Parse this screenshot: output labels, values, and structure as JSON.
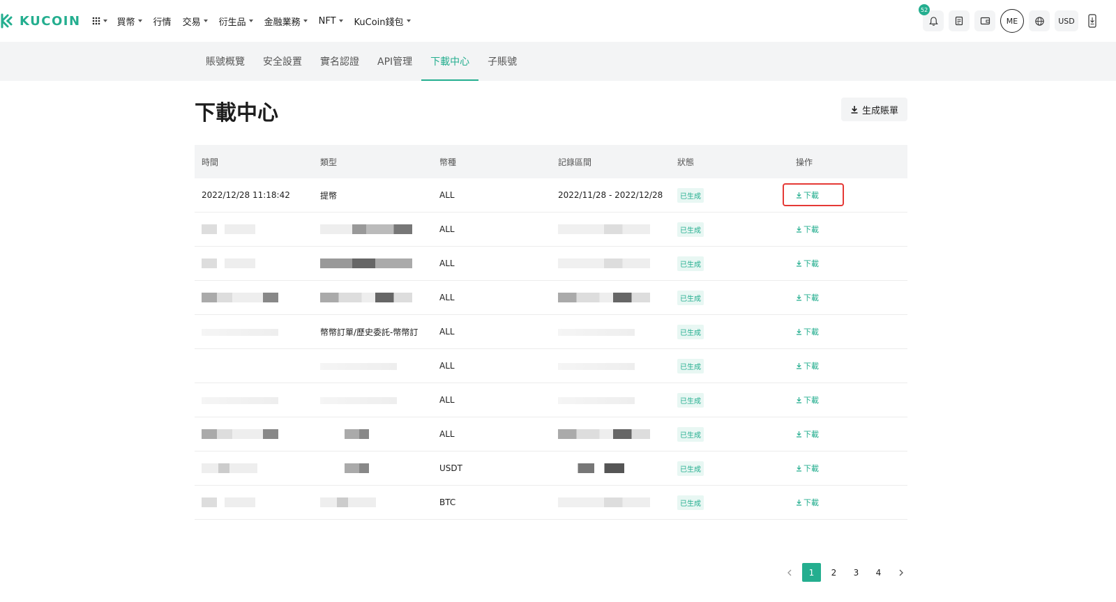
{
  "brand": {
    "name": "KUCOIN",
    "accent": "#24ae8f"
  },
  "topnav": {
    "items": [
      {
        "label": "買幣",
        "dropdown": true
      },
      {
        "label": "行情",
        "dropdown": false
      },
      {
        "label": "交易",
        "dropdown": true
      },
      {
        "label": "衍生品",
        "dropdown": true
      },
      {
        "label": "金融業務",
        "dropdown": true
      },
      {
        "label": "NFT",
        "dropdown": true
      },
      {
        "label": "KuCoin錢包",
        "dropdown": true
      }
    ],
    "notification_count": "52",
    "avatar_initials": "ME",
    "currency": "USD"
  },
  "tabs": [
    {
      "label": "賬號概覽",
      "active": false
    },
    {
      "label": "安全設置",
      "active": false
    },
    {
      "label": "實名認證",
      "active": false
    },
    {
      "label": "API管理",
      "active": false
    },
    {
      "label": "下載中心",
      "active": true
    },
    {
      "label": "子賬號",
      "active": false
    }
  ],
  "page": {
    "title": "下載中心",
    "generate_button": "生成賬單"
  },
  "table": {
    "columns": [
      "時間",
      "類型",
      "幣種",
      "記錄區間",
      "狀態",
      "操作"
    ],
    "rows": [
      {
        "time": "2022/12/28 11:18:42",
        "type": "提幣",
        "coin": "ALL",
        "range": "2022/11/28 - 2022/12/28",
        "status": "已生成",
        "action": "下載"
      },
      {
        "time": "",
        "type": "",
        "coin": "ALL",
        "range": "",
        "status": "已生成",
        "action": "下載"
      },
      {
        "time": "",
        "type": "",
        "coin": "ALL",
        "range": "",
        "status": "已生成",
        "action": "下載"
      },
      {
        "time": "",
        "type": "",
        "coin": "ALL",
        "range": "",
        "status": "已生成",
        "action": "下載"
      },
      {
        "time": "",
        "type": "幣幣訂單/歷史委託-幣幣訂",
        "coin": "ALL",
        "range": "",
        "status": "已生成",
        "action": "下載"
      },
      {
        "time": "",
        "type": "",
        "coin": "ALL",
        "range": "",
        "status": "已生成",
        "action": "下載"
      },
      {
        "time": "",
        "type": "",
        "coin": "ALL",
        "range": "",
        "status": "已生成",
        "action": "下載"
      },
      {
        "time": "",
        "type": "",
        "coin": "ALL",
        "range": "",
        "status": "已生成",
        "action": "下載"
      },
      {
        "time": "",
        "type": "",
        "coin": "USDT",
        "range": "",
        "status": "已生成",
        "action": "下載"
      },
      {
        "time": "",
        "type": "",
        "coin": "BTC",
        "range": "",
        "status": "已生成",
        "action": "下載"
      }
    ]
  },
  "pagination": {
    "pages": [
      "1",
      "2",
      "3",
      "4"
    ],
    "current": "1"
  }
}
